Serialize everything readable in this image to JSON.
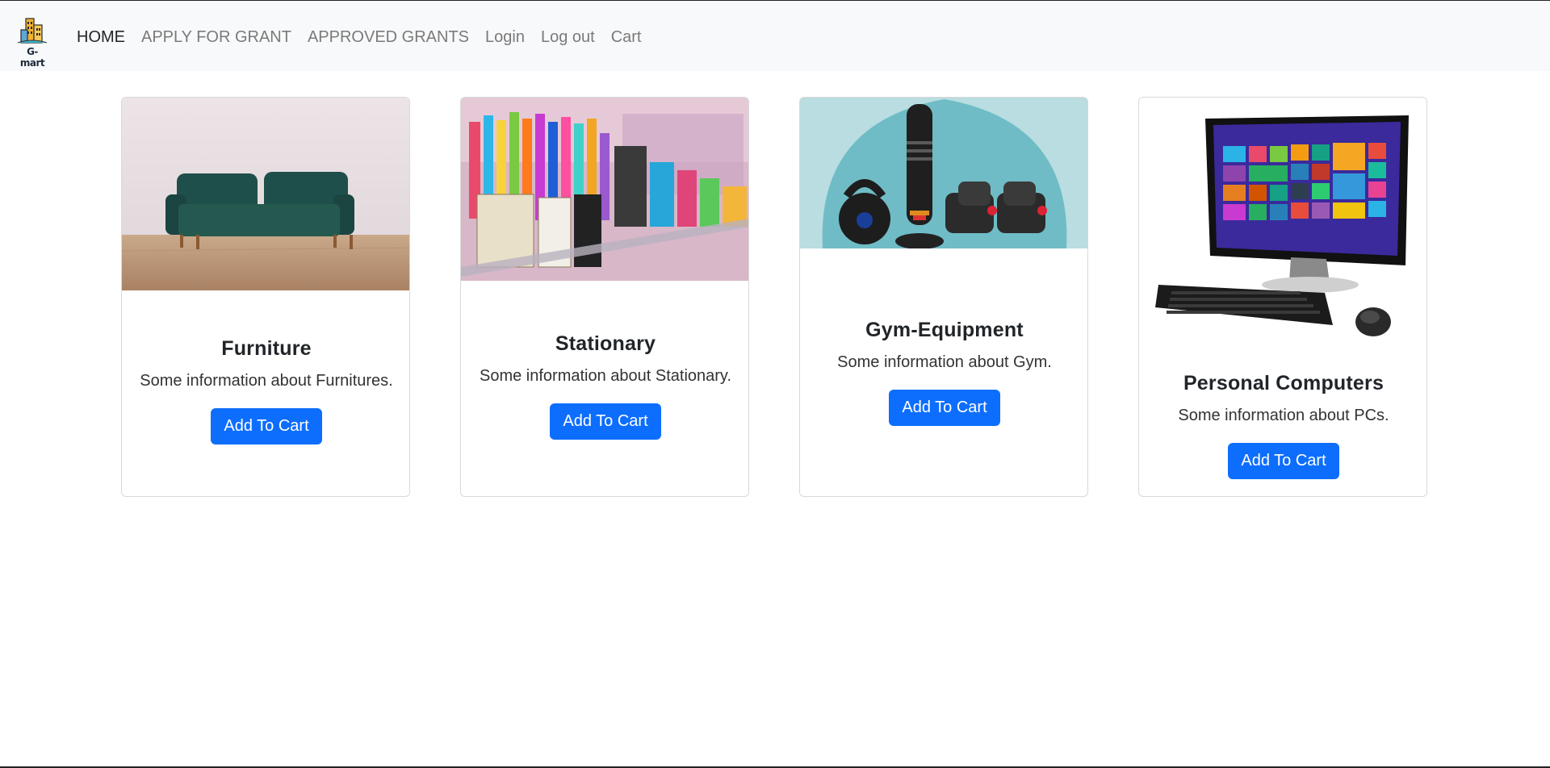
{
  "brand": {
    "name": "G-mart"
  },
  "nav": {
    "items": [
      {
        "label": "HOME"
      },
      {
        "label": "APPLY FOR GRANT"
      },
      {
        "label": "APPROVED GRANTS"
      },
      {
        "label": "Login"
      },
      {
        "label": "Log out"
      },
      {
        "label": "Cart"
      }
    ]
  },
  "cards": [
    {
      "title": "Furniture",
      "text": "Some information about Furnitures.",
      "button": "Add To Cart"
    },
    {
      "title": "Stationary",
      "text": "Some information about Stationary.",
      "button": "Add To Cart"
    },
    {
      "title": "Gym-Equipment",
      "text": "Some information about Gym.",
      "button": "Add To Cart"
    },
    {
      "title": "Personal Computers",
      "text": "Some information about PCs.",
      "button": "Add To Cart"
    }
  ],
  "colors": {
    "navbar_bg": "#f8f9fa",
    "button_bg": "#0d6efd",
    "nav_text": "#7a7a7a",
    "nav_active": "#212529"
  }
}
